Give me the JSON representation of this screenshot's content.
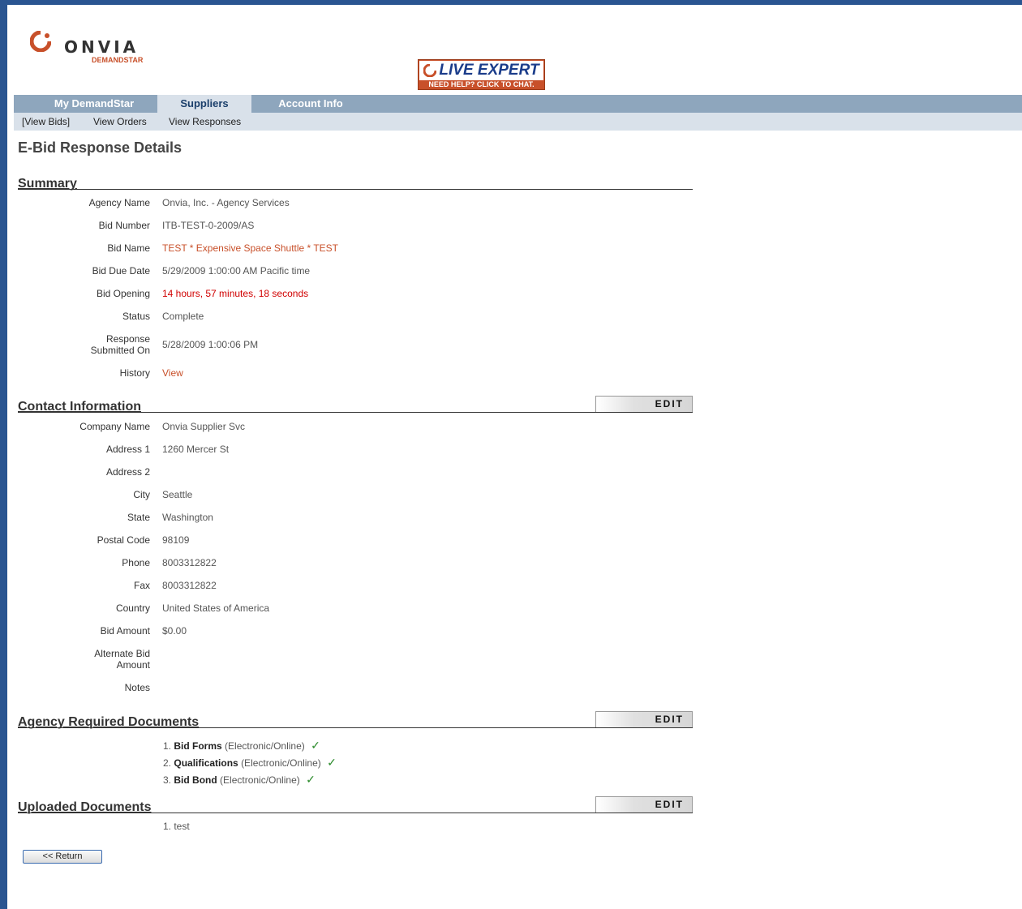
{
  "header": {
    "logo_name": "ONVIA",
    "logo_sub": "DEMANDSTAR",
    "live_expert": {
      "title": "LIVE EXPERT",
      "subtitle": "NEED HELP? CLICK TO CHAT."
    }
  },
  "nav": {
    "tabs": [
      {
        "label": "My DemandStar"
      },
      {
        "label": "Suppliers"
      },
      {
        "label": "Account Info"
      }
    ],
    "sub": [
      {
        "label": "[View Bids]"
      },
      {
        "label": "View Orders"
      },
      {
        "label": "View Responses"
      }
    ]
  },
  "page_title": "E-Bid Response Details",
  "summary": {
    "title": "Summary",
    "rows": [
      {
        "label": "Agency Name",
        "value": "Onvia, Inc. - Agency Services"
      },
      {
        "label": "Bid Number",
        "value": "ITB-TEST-0-2009/AS"
      },
      {
        "label": "Bid Name",
        "value": "TEST * Expensive Space Shuttle * TEST"
      },
      {
        "label": "Bid Due Date",
        "value": "5/29/2009 1:00:00 AM Pacific time"
      },
      {
        "label": "Bid Opening",
        "value": "14 hours, 57 minutes, 18 seconds"
      },
      {
        "label": "Status",
        "value": "Complete"
      },
      {
        "label": "Response Submitted On",
        "value": "5/28/2009 1:00:06 PM"
      },
      {
        "label": "History",
        "value": "View"
      }
    ]
  },
  "contact": {
    "title": "Contact Information",
    "edit_label": "EDIT",
    "rows": [
      {
        "label": "Company Name",
        "value": "Onvia Supplier Svc"
      },
      {
        "label": "Address 1",
        "value": "1260 Mercer St"
      },
      {
        "label": "Address 2",
        "value": ""
      },
      {
        "label": "City",
        "value": "Seattle"
      },
      {
        "label": "State",
        "value": "Washington"
      },
      {
        "label": "Postal Code",
        "value": "98109"
      },
      {
        "label": "Phone",
        "value": "8003312822"
      },
      {
        "label": "Fax",
        "value": "8003312822"
      },
      {
        "label": "Country",
        "value": "United States of America"
      },
      {
        "label": "Bid Amount",
        "value": "$0.00"
      },
      {
        "label": "Alternate Bid Amount",
        "value": ""
      },
      {
        "label": "Notes",
        "value": ""
      }
    ]
  },
  "agency_docs": {
    "title": "Agency Required Documents",
    "edit_label": "EDIT",
    "items": [
      {
        "num": "1.",
        "name": "Bid Forms",
        "type": "(Electronic/Online)"
      },
      {
        "num": "2.",
        "name": "Qualifications",
        "type": "(Electronic/Online)"
      },
      {
        "num": "3.",
        "name": "Bid Bond",
        "type": "(Electronic/Online)"
      }
    ]
  },
  "uploaded_docs": {
    "title": "Uploaded Documents",
    "edit_label": "EDIT",
    "items": [
      {
        "text": "1. test"
      }
    ]
  },
  "return_button": "<< Return",
  "colors": {
    "accent": "#c8502a",
    "alert": "#d00000",
    "nav": "#8ea6bd",
    "frame": "#2a5591"
  }
}
